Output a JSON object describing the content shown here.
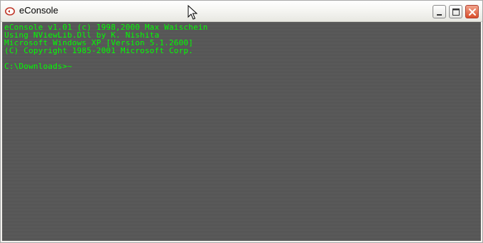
{
  "window": {
    "title": "eConsole"
  },
  "console": {
    "lines": [
      "eConsole v1.01 (c) 1998,2000 Max Waischein",
      "Using NViewLib.Dll by K. Nishita",
      "Microsoft Windows XP [Version 5.1.2600]",
      "(C) Copyright 1985-2001 Microsoft Corp."
    ],
    "prompt": "C:\\Downloads>~"
  },
  "colors": {
    "console_text": "#00ff00",
    "console_background": "#555555"
  },
  "icons": {
    "app": "econsole-app-icon",
    "minimize": "minimize-icon",
    "maximize": "maximize-icon",
    "close": "close-icon",
    "cursor": "mouse-pointer-icon"
  }
}
